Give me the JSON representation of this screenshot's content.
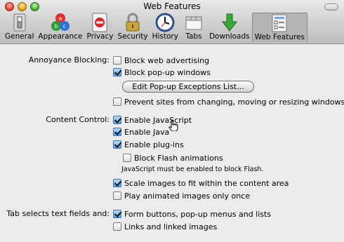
{
  "window": {
    "title": "Web Features",
    "toolbar": [
      {
        "label": "General",
        "icon": "light-switch-icon"
      },
      {
        "label": "Appearance",
        "icon": "abc-circles-icon"
      },
      {
        "label": "Privacy",
        "icon": "no-entry-sign-icon"
      },
      {
        "label": "Security",
        "icon": "padlock-icon"
      },
      {
        "label": "History",
        "icon": "clock-icon"
      },
      {
        "label": "Tabs",
        "icon": "tabs-icon"
      },
      {
        "label": "Downloads",
        "icon": "green-down-arrow-icon"
      },
      {
        "label": "Web Features",
        "icon": "web-features-icon",
        "selected": true
      }
    ]
  },
  "annoyance": {
    "label": "Annoyance Blocking:",
    "block_ads": {
      "label": "Block web advertising",
      "checked": false
    },
    "block_popups": {
      "label": "Block pop-up windows",
      "checked": true
    },
    "edit_button": "Edit Pop-up Exceptions List...",
    "prevent_resize": {
      "label": "Prevent sites from changing, moving or resizing windows",
      "checked": false
    }
  },
  "content_control": {
    "label": "Content Control:",
    "javascript": {
      "label": "Enable JavaScript",
      "checked": true
    },
    "java": {
      "label": "Enable Java",
      "checked": true
    },
    "plugins": {
      "label": "Enable plug-ins",
      "checked": true
    },
    "block_flash": {
      "label": "Block Flash animations",
      "checked": false
    },
    "flash_note": "JavaScript must be enabled to block Flash.",
    "scale_images": {
      "label": "Scale images to fit within the content area",
      "checked": true
    },
    "animated_once": {
      "label": "Play animated images only once",
      "checked": false
    }
  },
  "tab_selects": {
    "label": "Tab selects text fields and:",
    "form_buttons": {
      "label": "Form buttons, pop-up menus and lists",
      "checked": true
    },
    "links": {
      "label": "Links and linked images",
      "checked": false
    }
  }
}
